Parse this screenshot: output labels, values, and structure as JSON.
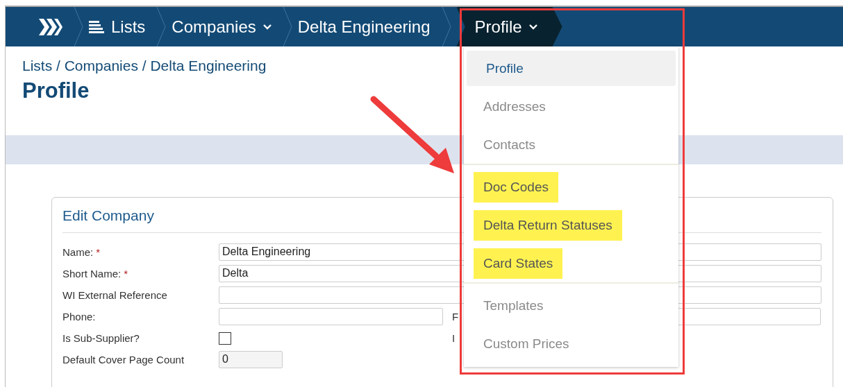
{
  "nav": {
    "crumbs": [
      {
        "kind": "list",
        "label": "Lists",
        "selected": false
      },
      {
        "kind": "dropdown",
        "label": "Companies",
        "selected": false
      },
      {
        "kind": "plain",
        "label": "Delta Engineering",
        "selected": false
      },
      {
        "kind": "dropdown",
        "label": "Profile",
        "selected": true
      }
    ]
  },
  "breadcrumb": "Lists / Companies / Delta Engineering",
  "title": "Profile",
  "card": {
    "title": "Edit Company",
    "fields": [
      {
        "kind": "wide",
        "label": "Name:",
        "required_mark": "*",
        "value": "Delta Engineering"
      },
      {
        "kind": "wide",
        "label": "Short Name:",
        "required_mark": "*",
        "value": "Delta"
      },
      {
        "kind": "wide",
        "label": "WI External Reference"
      },
      {
        "kind": "half",
        "label": "Phone:",
        "side_label": "F"
      },
      {
        "kind": "checkbox",
        "label": "Is Sub-Supplier?",
        "checked": false,
        "side_label": "I"
      },
      {
        "kind": "short",
        "label": "Default Cover Page Count",
        "value": "0"
      }
    ]
  },
  "menu": {
    "groups": [
      {
        "items": [
          {
            "label": "Profile",
            "selected": true,
            "highlighted": false
          },
          {
            "label": "Addresses",
            "selected": false,
            "highlighted": false
          },
          {
            "label": "Contacts",
            "selected": false,
            "highlighted": false
          }
        ]
      },
      {
        "items": [
          {
            "label": "Doc Codes",
            "selected": false,
            "highlighted": true
          },
          {
            "label": "Delta Return Statuses",
            "selected": false,
            "highlighted": true
          },
          {
            "label": "Card States",
            "selected": false,
            "highlighted": true
          }
        ]
      },
      {
        "items": [
          {
            "label": "Templates",
            "selected": false,
            "highlighted": false
          },
          {
            "label": "Custom Prices",
            "selected": false,
            "highlighted": false
          }
        ]
      }
    ]
  }
}
